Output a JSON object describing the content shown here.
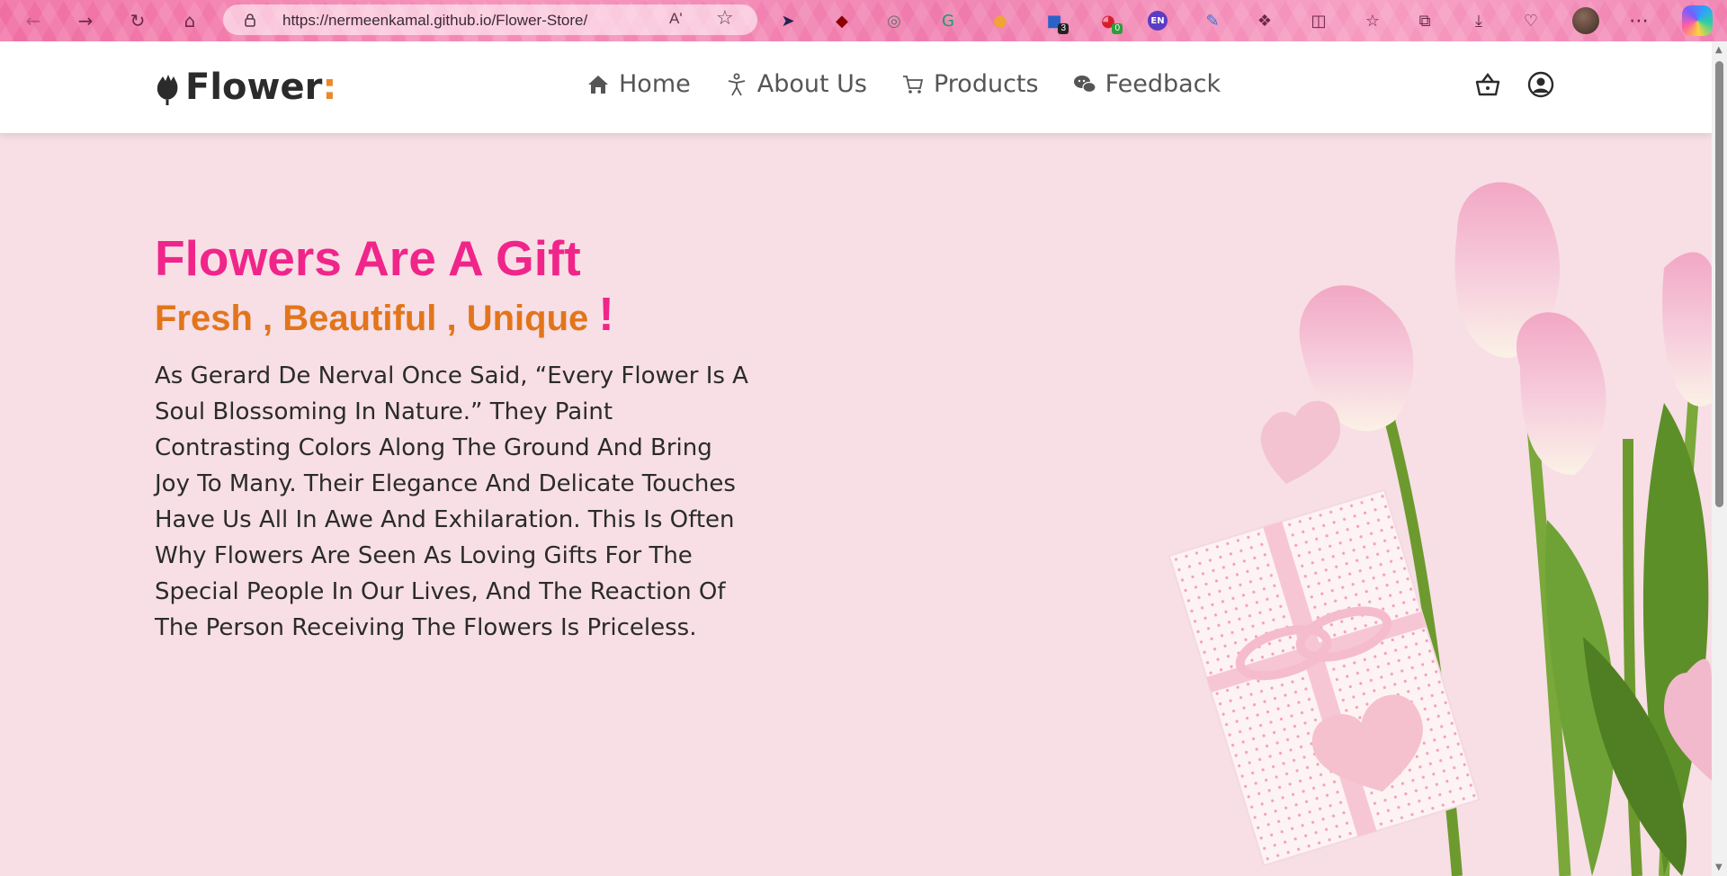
{
  "browser": {
    "url": "https://nermeenkamal.github.io/Flower-Store/",
    "read_aloud_label": "Aʹ",
    "extensions": [
      {
        "name": "cursor-extension-icon",
        "glyph": "➤",
        "color": "#1c2550"
      },
      {
        "name": "ublock-icon",
        "glyph": "◆",
        "color": "#8b0000"
      },
      {
        "name": "eyes-extension-icon",
        "glyph": "◎",
        "color": "#6c6c6c"
      },
      {
        "name": "grammarly-icon",
        "glyph": "G",
        "color": "#15a06a"
      },
      {
        "name": "egg-extension-icon",
        "glyph": "●",
        "color": "#f1a33a"
      },
      {
        "name": "ghostery-icon",
        "glyph": "■",
        "color": "#2a62c9",
        "badge": "3",
        "badge_color": "#222"
      },
      {
        "name": "password-extension-icon",
        "glyph": "◕",
        "color": "#d61f2a",
        "badge": "0",
        "badge_color": "#2c9e3a"
      },
      {
        "name": "language-extension-icon",
        "glyph": "EN",
        "color": "#5b3cc4"
      },
      {
        "name": "eyedropper-icon",
        "glyph": "✎",
        "color": "#3a6fd8"
      },
      {
        "name": "extensions-puzzle-icon",
        "glyph": "❖",
        "color": "#6b2846"
      },
      {
        "name": "split-screen-icon",
        "glyph": "◫",
        "color": "#6b2846"
      },
      {
        "name": "favorites-icon",
        "glyph": "☆",
        "color": "#6b2846"
      },
      {
        "name": "collections-icon",
        "glyph": "⧉",
        "color": "#6b2846"
      },
      {
        "name": "downloads-icon",
        "glyph": "⤓",
        "color": "#6b2846"
      },
      {
        "name": "browser-essentials-icon",
        "glyph": "♡",
        "color": "#6b2846"
      }
    ]
  },
  "site": {
    "logo_word": "Flower",
    "logo_colon": ":",
    "menu": [
      {
        "label": "Home",
        "icon": "home-icon"
      },
      {
        "label": "About Us",
        "icon": "person-icon"
      },
      {
        "label": "Products",
        "icon": "cart-icon"
      },
      {
        "label": "Feedback",
        "icon": "chat-icon"
      }
    ]
  },
  "hero": {
    "title": "Flowers Are A Gift",
    "subtitle": "Fresh , Beautiful , Unique",
    "subtitle_bang": "!",
    "body": "As Gerard De Nerval Once Said, “Every Flower Is A Soul Blossoming In Nature.” They Paint Contrasting Colors Along The Ground And Bring Joy To Many. Their Elegance And Delicate Touches Have Us All In Awe And Exhilaration. This Is Often Why Flowers Are Seen As Loving Gifts For The Special People In Our Lives, And The Reaction Of The Person Receiving The Flowers Is Priceless."
  },
  "colors": {
    "title_pink": "#f0258a",
    "subtitle_orange": "#e2751b",
    "logo_accent": "#e8892b",
    "page_bg": "#f7dfe5"
  }
}
